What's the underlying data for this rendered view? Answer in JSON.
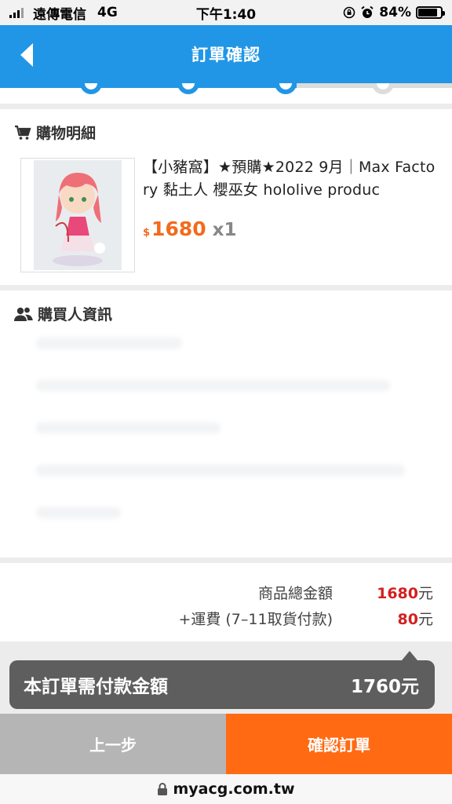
{
  "status_bar": {
    "carrier": "遠傳電信",
    "network": "4G",
    "time": "下午1:40",
    "battery_percent": "84%",
    "battery_level": 0.84
  },
  "header": {
    "title": "訂單確認",
    "back_icon": "chevron-left-icon"
  },
  "stepper": {
    "total_steps": 4,
    "current_step": 3,
    "active_color": "#2196e6",
    "inactive_color": "#dcdcdc"
  },
  "cart": {
    "section_title": "購物明細",
    "icon": "cart-icon",
    "item": {
      "name": "【小豬窩】★預購★2022 9月｜Max Factory 黏土人 櫻巫女 hololive produc",
      "currency_symbol": "$",
      "price": "1680",
      "quantity": "x1"
    }
  },
  "buyer": {
    "section_title": "購買人資訊",
    "icon": "users-icon"
  },
  "summary": {
    "subtotal_label": "商品總金額",
    "subtotal_value": "1680",
    "subtotal_unit": "元",
    "shipping_label": "+運費 (7–11取貨付款)",
    "shipping_value": "80",
    "shipping_unit": "元"
  },
  "total": {
    "label": "本訂單需付款金額",
    "value": "1760元"
  },
  "buttons": {
    "prev": "上一步",
    "confirm": "確認訂單"
  },
  "browser": {
    "url": "myacg.com.tw",
    "lock_icon": "lock-icon"
  },
  "colors": {
    "primary": "#2196e6",
    "accent": "#ff6a13",
    "price": "#f26b1d",
    "summary_number": "#d32020"
  }
}
